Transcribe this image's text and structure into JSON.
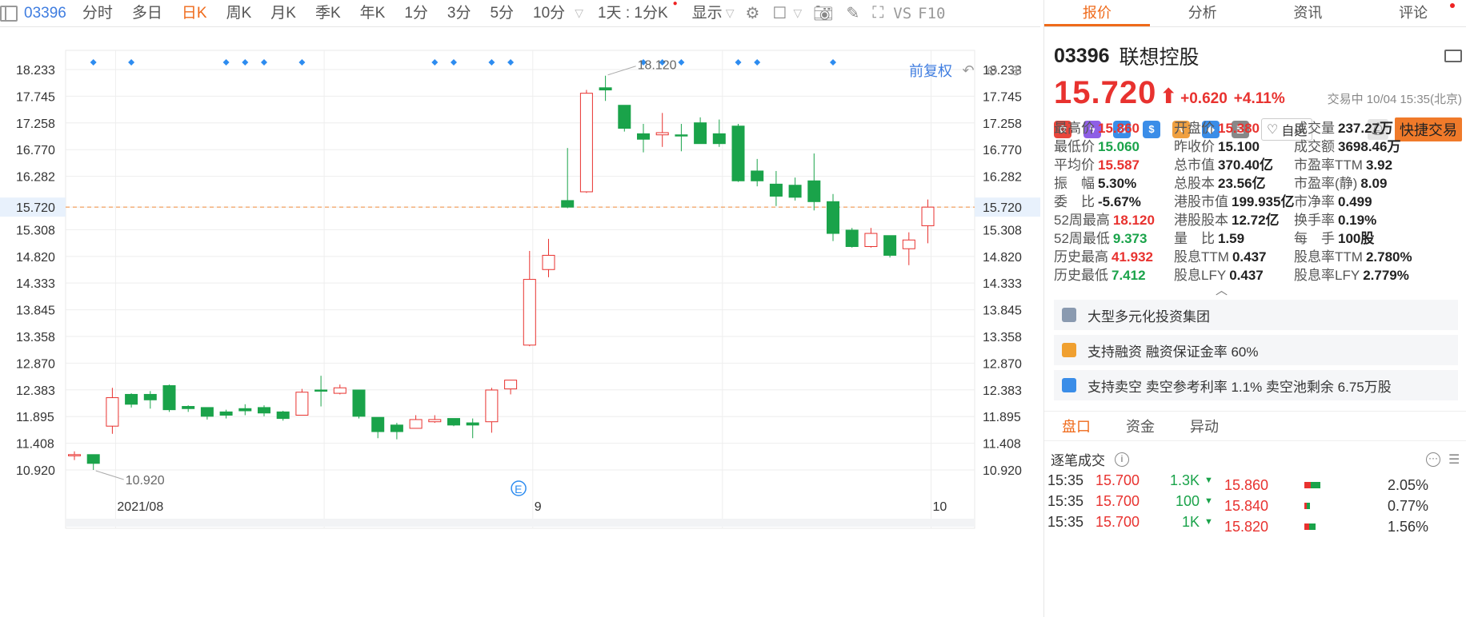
{
  "toolbar": {
    "code": "03396",
    "periods": [
      {
        "label": "分时",
        "active": false
      },
      {
        "label": "多日",
        "active": false
      },
      {
        "label": "日K",
        "active": true
      },
      {
        "label": "周K",
        "active": false
      },
      {
        "label": "月K",
        "active": false
      },
      {
        "label": "季K",
        "active": false
      },
      {
        "label": "年K",
        "active": false
      },
      {
        "label": "1分",
        "active": false
      },
      {
        "label": "3分",
        "active": false
      },
      {
        "label": "5分",
        "active": false
      },
      {
        "label": "10分",
        "active": false
      }
    ],
    "interval_select": "1天 : 1分K",
    "display_select": "显示",
    "vs_label": "VS",
    "f10_label": "F10",
    "icons": [
      "chevron-down-icon",
      "settings-icon",
      "square-icon",
      "camera-icon",
      "pencil-icon",
      "fullscreen-icon"
    ]
  },
  "chart_tools": {
    "adjust_label": "前复权",
    "icons": [
      "undo-icon",
      "zoom-out-icon",
      "zoom-in-icon"
    ]
  },
  "chart_data": {
    "type": "candlestick",
    "y_ticks": [
      "18.233",
      "17.745",
      "17.258",
      "16.770",
      "16.282",
      "15.720",
      "15.308",
      "14.820",
      "14.333",
      "13.845",
      "13.358",
      "12.870",
      "12.383",
      "11.895",
      "11.408",
      "10.920"
    ],
    "ylim": [
      10.92,
      18.233
    ],
    "x_ticks": [
      {
        "label": "2021/08",
        "index": 2
      },
      {
        "label": "9",
        "index": 24
      },
      {
        "label": "10",
        "index": 45
      }
    ],
    "current_price": 15.72,
    "max_annotation": {
      "label": "18.120",
      "index": 28,
      "value": 18.12
    },
    "min_annotation": {
      "label": "10.920",
      "index": 1,
      "value": 10.92
    },
    "dividend_marker_label": "E",
    "dividend_marker_index": 23,
    "event_marker_indices": [
      1,
      3,
      8,
      9,
      10,
      12,
      19,
      20,
      22,
      23,
      30,
      31,
      32,
      35,
      36,
      40
    ],
    "candles": [
      {
        "o": 11.18,
        "h": 11.26,
        "l": 11.1,
        "c": 11.2
      },
      {
        "o": 11.2,
        "h": 11.2,
        "l": 10.92,
        "c": 11.04
      },
      {
        "o": 11.72,
        "h": 12.42,
        "l": 11.58,
        "c": 12.24
      },
      {
        "o": 12.3,
        "h": 12.32,
        "l": 12.06,
        "c": 12.12
      },
      {
        "o": 12.3,
        "h": 12.36,
        "l": 12.04,
        "c": 12.2
      },
      {
        "o": 12.46,
        "h": 12.48,
        "l": 11.98,
        "c": 12.02
      },
      {
        "o": 12.08,
        "h": 12.1,
        "l": 11.98,
        "c": 12.04
      },
      {
        "o": 12.06,
        "h": 12.06,
        "l": 11.84,
        "c": 11.9
      },
      {
        "o": 11.98,
        "h": 12.02,
        "l": 11.86,
        "c": 11.92
      },
      {
        "o": 12.04,
        "h": 12.12,
        "l": 11.92,
        "c": 12.0
      },
      {
        "o": 12.06,
        "h": 12.1,
        "l": 11.9,
        "c": 11.96
      },
      {
        "o": 11.98,
        "h": 12.0,
        "l": 11.82,
        "c": 11.86
      },
      {
        "o": 11.92,
        "h": 12.4,
        "l": 11.92,
        "c": 12.34
      },
      {
        "o": 12.38,
        "h": 12.64,
        "l": 12.08,
        "c": 12.36
      },
      {
        "o": 12.32,
        "h": 12.48,
        "l": 12.3,
        "c": 12.42
      },
      {
        "o": 12.38,
        "h": 12.38,
        "l": 11.86,
        "c": 11.9
      },
      {
        "o": 11.88,
        "h": 11.88,
        "l": 11.5,
        "c": 11.62
      },
      {
        "o": 11.74,
        "h": 11.78,
        "l": 11.48,
        "c": 11.62
      },
      {
        "o": 11.68,
        "h": 11.92,
        "l": 11.68,
        "c": 11.84
      },
      {
        "o": 11.8,
        "h": 11.92,
        "l": 11.78,
        "c": 11.84
      },
      {
        "o": 11.86,
        "h": 11.86,
        "l": 11.72,
        "c": 11.74
      },
      {
        "o": 11.78,
        "h": 11.86,
        "l": 11.5,
        "c": 11.74
      },
      {
        "o": 11.8,
        "h": 12.42,
        "l": 11.6,
        "c": 12.38
      },
      {
        "o": 12.4,
        "h": 12.56,
        "l": 12.3,
        "c": 12.56
      },
      {
        "o": 13.2,
        "h": 14.92,
        "l": 13.18,
        "c": 14.4
      },
      {
        "o": 14.58,
        "h": 15.14,
        "l": 14.44,
        "c": 14.84
      },
      {
        "o": 15.84,
        "h": 16.8,
        "l": 15.7,
        "c": 15.72
      },
      {
        "o": 16.0,
        "h": 17.86,
        "l": 15.98,
        "c": 17.8
      },
      {
        "o": 17.9,
        "h": 18.12,
        "l": 17.66,
        "c": 17.86
      },
      {
        "o": 17.58,
        "h": 17.58,
        "l": 17.1,
        "c": 17.16
      },
      {
        "o": 17.06,
        "h": 17.24,
        "l": 16.72,
        "c": 16.96
      },
      {
        "o": 17.04,
        "h": 17.44,
        "l": 16.82,
        "c": 17.08
      },
      {
        "o": 17.04,
        "h": 17.24,
        "l": 16.74,
        "c": 17.02
      },
      {
        "o": 17.26,
        "h": 17.36,
        "l": 16.88,
        "c": 16.88
      },
      {
        "o": 17.06,
        "h": 17.32,
        "l": 16.82,
        "c": 16.88
      },
      {
        "o": 17.2,
        "h": 17.24,
        "l": 16.18,
        "c": 16.2
      },
      {
        "o": 16.38,
        "h": 16.6,
        "l": 16.1,
        "c": 16.2
      },
      {
        "o": 16.14,
        "h": 16.38,
        "l": 15.74,
        "c": 15.92
      },
      {
        "o": 16.12,
        "h": 16.26,
        "l": 15.84,
        "c": 15.9
      },
      {
        "o": 16.2,
        "h": 16.7,
        "l": 15.66,
        "c": 15.82
      },
      {
        "o": 15.82,
        "h": 15.96,
        "l": 15.1,
        "c": 15.24
      },
      {
        "o": 15.3,
        "h": 15.34,
        "l": 14.98,
        "c": 15.0
      },
      {
        "o": 15.0,
        "h": 15.34,
        "l": 14.98,
        "c": 15.24
      },
      {
        "o": 15.2,
        "h": 15.2,
        "l": 14.8,
        "c": 14.84
      },
      {
        "o": 14.96,
        "h": 15.26,
        "l": 14.66,
        "c": 15.12
      },
      {
        "o": 15.38,
        "h": 15.86,
        "l": 15.06,
        "c": 15.72
      }
    ]
  },
  "panel": {
    "tabs": [
      {
        "label": "报价",
        "active": true
      },
      {
        "label": "分析",
        "active": false
      },
      {
        "label": "资讯",
        "active": false
      },
      {
        "label": "评论",
        "active": false
      }
    ],
    "code": "03396",
    "name": "联想控股",
    "price": "15.720",
    "arrow": "⬆",
    "change": "+0.620",
    "change_pct": "+4.11%",
    "status": "交易中 10/04 15:35(北京)",
    "watch_label": "自选",
    "trade_label": "快捷交易",
    "icon_colors": [
      "#e8463c",
      "#8e5fe6",
      "#3a8de8",
      "#3a8de8",
      "#f0a040",
      "#3a8de8",
      "#888888"
    ],
    "quote": [
      {
        "label": "最高价",
        "value": "15.860",
        "color": "up"
      },
      {
        "label": "开盘价",
        "value": "15.380",
        "color": "up"
      },
      {
        "label": "成交量",
        "value": "237.27万",
        "color": ""
      },
      {
        "label": "最低价",
        "value": "15.060",
        "color": "down"
      },
      {
        "label": "昨收价",
        "value": "15.100",
        "color": ""
      },
      {
        "label": "成交额",
        "value": "3698.46万",
        "color": ""
      },
      {
        "label": "平均价",
        "value": "15.587",
        "color": "up"
      },
      {
        "label": "总市值",
        "value": "370.40亿",
        "color": ""
      },
      {
        "label": "市盈率TTM",
        "value": "3.92",
        "color": ""
      },
      {
        "label": "振　幅",
        "value": "5.30%",
        "color": ""
      },
      {
        "label": "总股本",
        "value": "23.56亿",
        "color": ""
      },
      {
        "label": "市盈率(静)",
        "value": "8.09",
        "color": ""
      },
      {
        "label": "委　比",
        "value": "-5.67%",
        "color": ""
      },
      {
        "label": "港股市值",
        "value": "199.935亿",
        "color": ""
      },
      {
        "label": "市净率",
        "value": "0.499",
        "color": ""
      },
      {
        "label": "52周最高",
        "value": "18.120",
        "color": "up"
      },
      {
        "label": "港股股本",
        "value": "12.72亿",
        "color": ""
      },
      {
        "label": "换手率",
        "value": "0.19%",
        "color": ""
      },
      {
        "label": "52周最低",
        "value": "9.373",
        "color": "down"
      },
      {
        "label": "量　比",
        "value": "1.59",
        "color": ""
      },
      {
        "label": "每　手",
        "value": "100股",
        "color": ""
      },
      {
        "label": "历史最高",
        "value": "41.932",
        "color": "up"
      },
      {
        "label": "股息TTM",
        "value": "0.437",
        "color": ""
      },
      {
        "label": "股息率TTM",
        "value": "2.780%",
        "color": ""
      },
      {
        "label": "历史最低",
        "value": "7.412",
        "color": "down"
      },
      {
        "label": "股息LFY",
        "value": "0.437",
        "color": ""
      },
      {
        "label": "股息率LFY",
        "value": "2.779%",
        "color": ""
      }
    ],
    "info_cards": [
      {
        "text": "大型多元化投资集团",
        "icon": "book-icon",
        "color": "#8a9ab0"
      },
      {
        "text": "支持融资 融资保证金率 60%",
        "icon": "coin-icon",
        "color": "#f0a030"
      },
      {
        "text": "支持卖空 卖空参考利率 1.1% 卖空池剩余 6.75万股",
        "icon": "short-icon",
        "color": "#3a8de8"
      }
    ],
    "sub_tabs": [
      {
        "label": "盘口",
        "active": true
      },
      {
        "label": "资金",
        "active": false
      },
      {
        "label": "异动",
        "active": false
      }
    ],
    "trades_title": "逐笔成交",
    "trades": [
      {
        "time": "15:35",
        "price": "15.700",
        "vol": "1.3K"
      },
      {
        "time": "15:35",
        "price": "15.700",
        "vol": "100"
      },
      {
        "time": "15:35",
        "price": "15.700",
        "vol": "1K"
      }
    ],
    "depth": [
      {
        "price": "15.860",
        "pct": "2.05%",
        "red": 0.08,
        "green": 0.12
      },
      {
        "price": "15.840",
        "pct": "0.77%",
        "red": 0.03,
        "green": 0.04
      },
      {
        "price": "15.820",
        "pct": "1.56%",
        "red": 0.06,
        "green": 0.08
      }
    ]
  }
}
